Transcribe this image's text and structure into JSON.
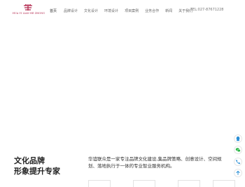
{
  "header": {
    "logo_text": "HUA YI LIAN HE ZHONG",
    "nav_items": [
      "首页",
      "品牌设计",
      "文化设计",
      "环境设计",
      "项目案例",
      "业务合作",
      "新闻",
      "关于我们"
    ],
    "tel": "TEL:027-87671228"
  },
  "hero": {
    "slogan_line1": "文化品牌",
    "slogan_line2": "形象提升专家",
    "intro": "华谊联众是一家专注品牌文化建设,集品牌策略、创意设计、空间规划、落地执行于一体的专业智业服务机构。"
  },
  "colors": {
    "brand": "#b1244b",
    "wechat": "#2fb84a",
    "accent_blue": "#2a8fd6"
  },
  "float_icons": [
    "qq-icon",
    "wechat-icon",
    "phone-icon",
    "back-to-top-icon"
  ]
}
